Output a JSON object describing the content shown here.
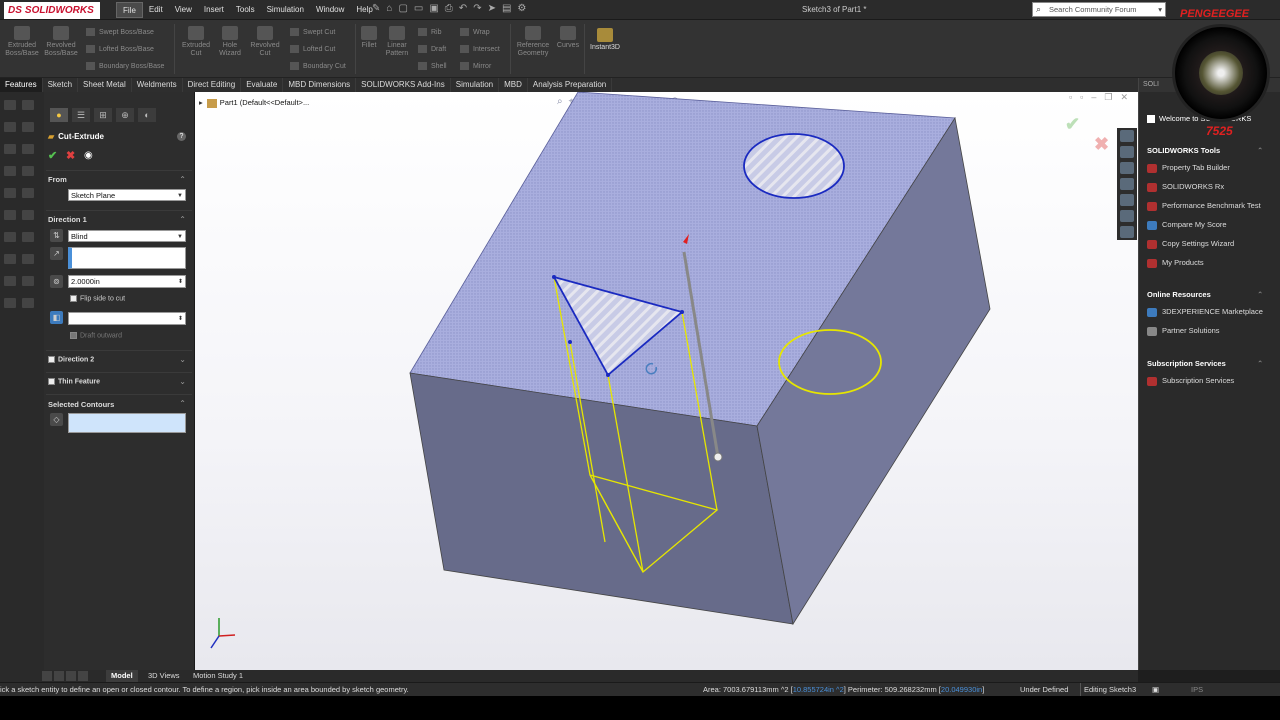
{
  "app": {
    "brand": "SOLIDWORKS",
    "brand_prefix": "DS",
    "doc_title": "Sketch3 of Part1 *",
    "search_placeholder": "Search Community Forum"
  },
  "menu": [
    "File",
    "Edit",
    "View",
    "Insert",
    "Tools",
    "Simulation",
    "Window",
    "Help"
  ],
  "command_manager": {
    "extruded_boss": "Extruded\nBoss/Base",
    "revolved_boss": "Revolved\nBoss/Base",
    "swept_boss": "Swept Boss/Base",
    "lofted_boss": "Lofted Boss/Base",
    "boundary_boss": "Boundary Boss/Base",
    "extruded_cut": "Extruded\nCut",
    "hole_wizard": "Hole\nWizard",
    "revolved_cut": "Revolved\nCut",
    "swept_cut": "Swept Cut",
    "lofted_cut": "Lofted Cut",
    "boundary_cut": "Boundary Cut",
    "fillet": "Fillet",
    "linear_pattern": "Linear\nPattern",
    "rib": "Rib",
    "draft": "Draft",
    "shell": "Shell",
    "wrap": "Wrap",
    "intersect": "Intersect",
    "mirror": "Mirror",
    "reference_geometry": "Reference\nGeometry",
    "curves": "Curves",
    "instant3d": "Instant3D"
  },
  "tabs": [
    "Features",
    "Sketch",
    "Sheet Metal",
    "Weldments",
    "Direct Editing",
    "Evaluate",
    "MBD Dimensions",
    "SOLIDWORKS Add-Ins",
    "Simulation",
    "MBD",
    "Analysis Preparation"
  ],
  "property_manager": {
    "title": "Cut-Extrude",
    "help": "?",
    "from_label": "From",
    "from_value": "Sketch Plane",
    "direction1_label": "Direction 1",
    "end_condition": "Blind",
    "depth": "2.0000in",
    "flip_side": "Flip side to cut",
    "draft_outward": "Draft outward",
    "direction2_label": "Direction 2",
    "thin_feature_label": "Thin Feature",
    "selected_contours_label": "Selected Contours"
  },
  "graphics": {
    "tree_item": "Part1  (Default<<Default>..."
  },
  "task_pane": {
    "header": "SOLI",
    "welcome": "Welcome to SOLIDWORKS",
    "tools_heading": "SOLIDWORKS Tools",
    "tools": [
      "Property Tab Builder",
      "SOLIDWORKS Rx",
      "Performance Benchmark Test",
      "Compare My Score",
      "Copy Settings Wizard",
      "My Products"
    ],
    "online_heading": "Online Resources",
    "online": [
      "3DEXPERIENCE Marketplace",
      "Partner Solutions"
    ],
    "subscription_heading": "Subscription Services",
    "subscription": [
      "Subscription Services"
    ]
  },
  "overlay": {
    "channel_name": "PENGEEGEE",
    "channel_number": "7525"
  },
  "bottom_tabs": [
    "Model",
    "3D Views",
    "Motion Study 1"
  ],
  "status": {
    "hint": "ick a sketch entity to define an open or closed contour. To define a region, pick inside an area bounded by sketch geometry.",
    "area_prefix": "Area: 7003.679113mm ^2 [",
    "area_in": "10.855724in ^2",
    "perimeter_prefix": "] Perimeter: 509.268232mm [",
    "perimeter_in": "20.049930in",
    "perimeter_suffix": "]",
    "definition": "Under Defined",
    "mode": "Editing Sketch3",
    "units": "IPS"
  },
  "colors": {
    "accent_red": "#c8102e",
    "sketch_blue": "#1a2ac0",
    "sketch_yellow": "#e6e600",
    "highlight_blue": "#4a90d9"
  }
}
